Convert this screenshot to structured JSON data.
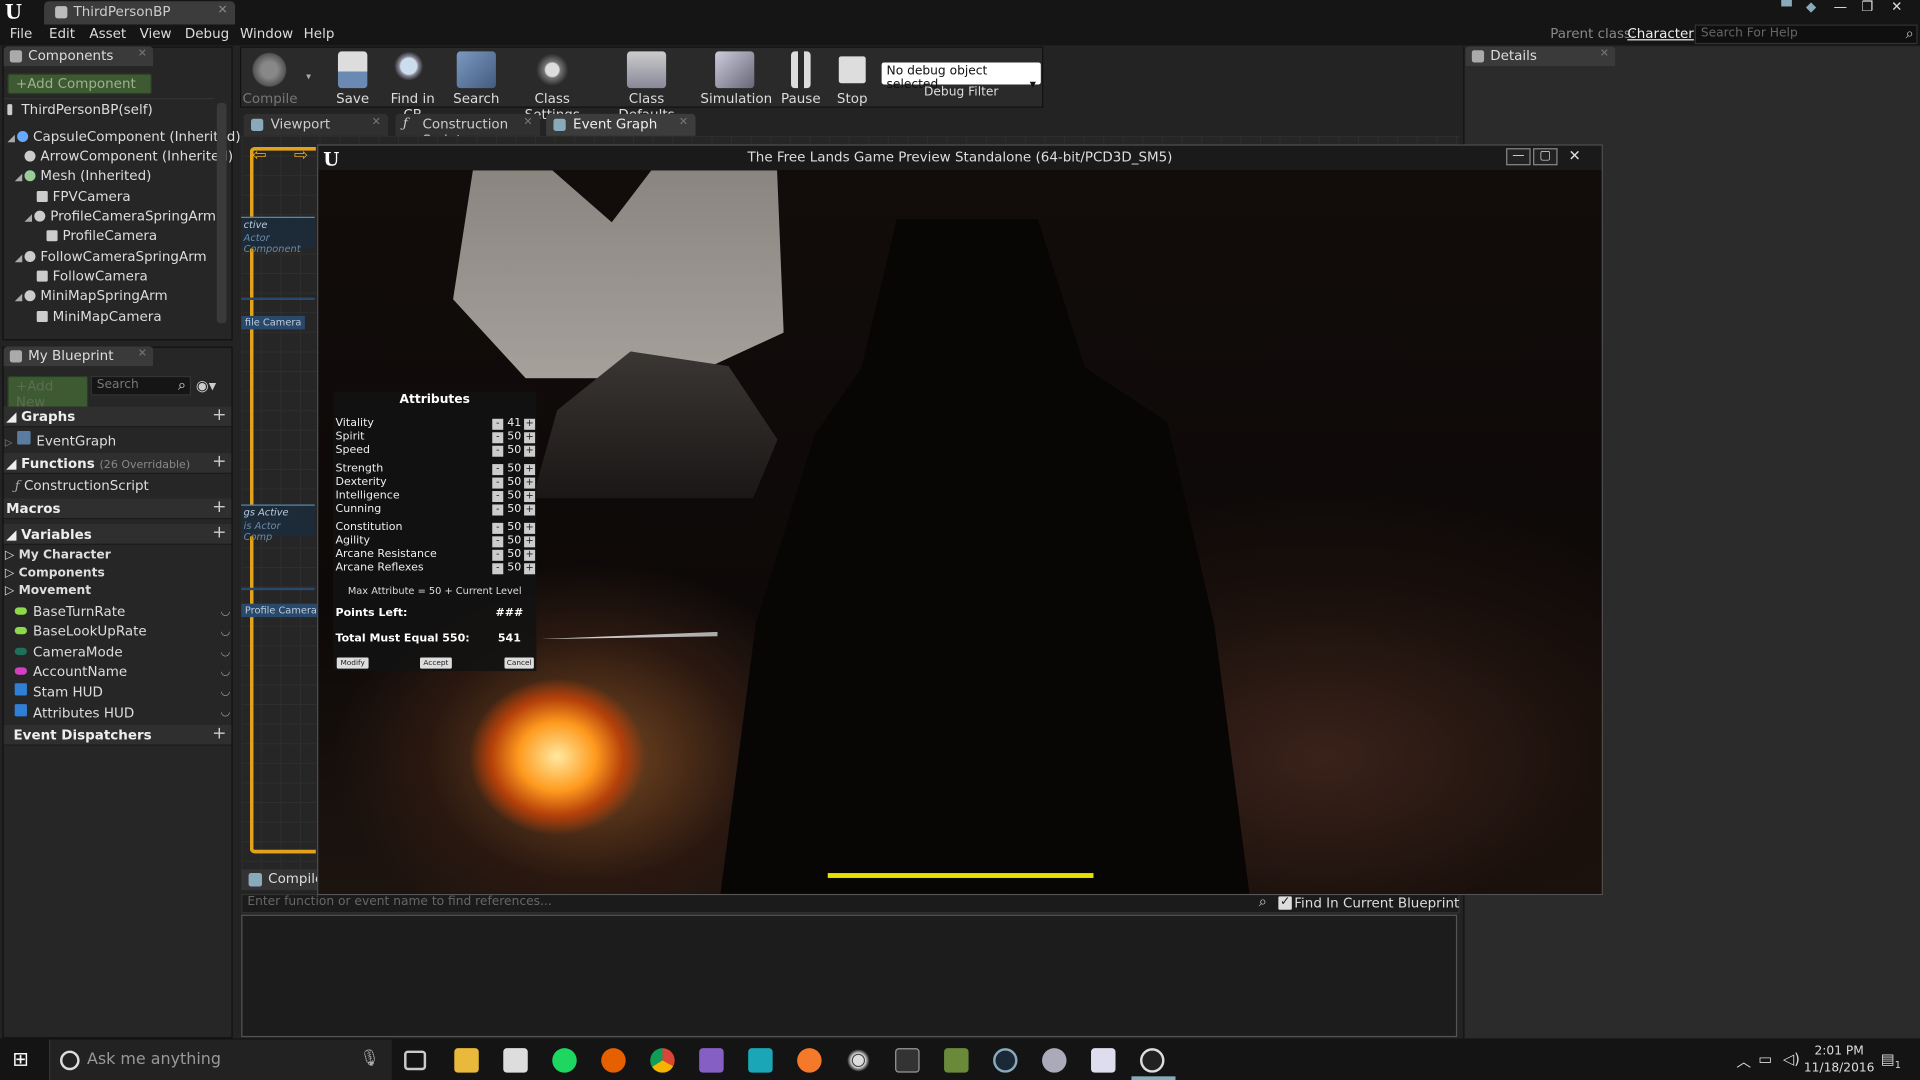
{
  "app": {
    "tab_title": "ThirdPersonBP",
    "menu": [
      "File",
      "Edit",
      "Asset",
      "View",
      "Debug",
      "Window",
      "Help"
    ],
    "parent_class_label": "Parent class:",
    "parent_class_value": "Character",
    "help_search_placeholder": "Search For Help"
  },
  "components_panel": {
    "tab": "Components",
    "add_button": "+Add Component",
    "root": "ThirdPersonBP(self)",
    "items": [
      "CapsuleComponent (Inherited)",
      "ArrowComponent (Inherited)",
      "Mesh (Inherited)",
      "FPVCamera",
      "ProfileCameraSpringArm",
      "ProfileCamera",
      "FollowCameraSpringArm",
      "FollowCamera",
      "MiniMapSpringArm",
      "MiniMapCamera"
    ]
  },
  "my_blueprint": {
    "tab": "My Blueprint",
    "add_new": "+Add New",
    "search_placeholder": "Search",
    "graphs_label": "Graphs",
    "graphs_item": "EventGraph",
    "functions_label": "Functions",
    "functions_sub": "(26 Overridable)",
    "functions_item": "ConstructionScript",
    "macros_label": "Macros",
    "variables_label": "Variables",
    "categories": [
      "My Character",
      "Components",
      "Movement"
    ],
    "variables": [
      {
        "name": "BaseTurnRate",
        "color": "#8cd94a"
      },
      {
        "name": "BaseLookUpRate",
        "color": "#8cd94a"
      },
      {
        "name": "CameraMode",
        "color": "#1f6f5a"
      },
      {
        "name": "AccountName",
        "color": "#d43fc4"
      },
      {
        "name": "Stam HUD",
        "color": "#2f7fd6"
      },
      {
        "name": "Attributes HUD",
        "color": "#2f7fd6"
      }
    ],
    "dispatchers_label": "Event Dispatchers"
  },
  "toolbar": {
    "compile": "Compile",
    "save": "Save",
    "find_in_cb": "Find in CB",
    "search": "Search",
    "class_settings": "Class Settings",
    "class_defaults": "Class Defaults",
    "simulation": "Simulation",
    "pause": "Pause",
    "stop": "Stop",
    "debug_select": "No debug object selected",
    "debug_filter": "Debug Filter"
  },
  "editor_tabs": [
    "Viewport",
    "Construction Script",
    "Event Graph"
  ],
  "graph_nodes": {
    "n1_title": "ctive",
    "n1_sub": "Actor Component",
    "n1_tag": "file Camera",
    "n2_title": "gs Active",
    "n2_sub": "is Actor Comp",
    "n2_tag": "Profile Camera"
  },
  "compile_tab": "Compile",
  "find": {
    "placeholder": "Enter function or event name to find references...",
    "checkbox_label": "Find In Current Blueprint Only"
  },
  "details_tab": "Details",
  "game_window": {
    "title": "The Free Lands Game Preview Standalone (64-bit/PCD3D_SM5)"
  },
  "attributes": {
    "title": "Attributes",
    "groups": [
      [
        {
          "name": "Vitality",
          "value": "41"
        },
        {
          "name": "Spirit",
          "value": "50"
        },
        {
          "name": "Speed",
          "value": "50"
        }
      ],
      [
        {
          "name": "Strength",
          "value": "50"
        },
        {
          "name": "Dexterity",
          "value": "50"
        },
        {
          "name": "Intelligence",
          "value": "50"
        },
        {
          "name": "Cunning",
          "value": "50"
        }
      ],
      [
        {
          "name": "Constitution",
          "value": "50"
        },
        {
          "name": "Agility",
          "value": "50"
        },
        {
          "name": "Arcane Resistance",
          "value": "50"
        },
        {
          "name": "Arcane Reflexes",
          "value": "50"
        }
      ]
    ],
    "max_note": "Max Attribute = 50 + Current Level",
    "points_left_label": "Points Left:",
    "points_left_value": "###",
    "total_label": "Total Must Equal 550:",
    "total_value": "541",
    "btn_modify": "Modify",
    "btn_accept": "Accept",
    "btn_cancel": "Cancel"
  },
  "taskbar": {
    "cortana": "Ask me anything",
    "time": "2:01 PM",
    "date": "11/18/2016",
    "notif_count": "1"
  }
}
